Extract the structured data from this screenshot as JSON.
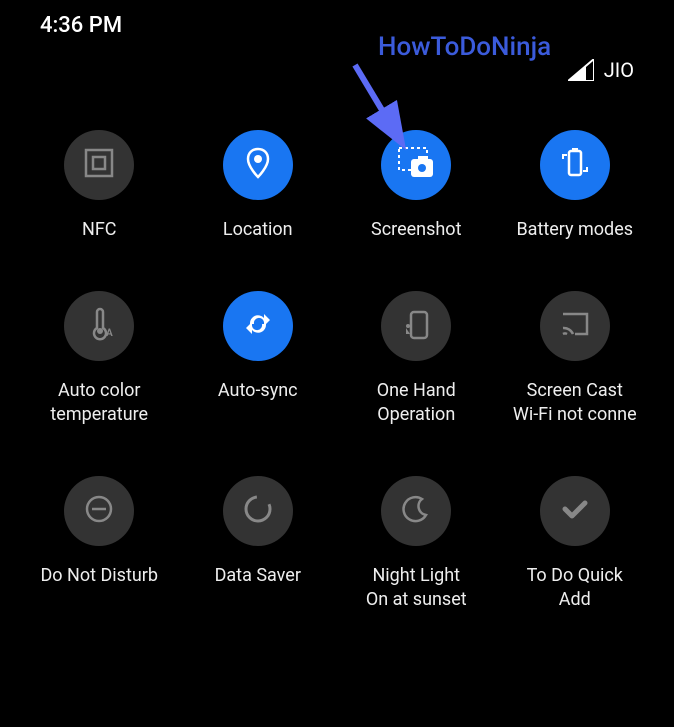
{
  "status": {
    "time": "4:36 PM",
    "carrier": "JIO"
  },
  "annotation": {
    "text": "HowToDoNinja"
  },
  "tiles": [
    {
      "label": "NFC",
      "active": false,
      "icon": "nfc"
    },
    {
      "label": "Location",
      "active": true,
      "icon": "location"
    },
    {
      "label": "Screenshot",
      "active": true,
      "icon": "screenshot"
    },
    {
      "label": "Battery modes",
      "active": true,
      "icon": "battery"
    },
    {
      "label": "Auto color\ntemperature",
      "active": false,
      "icon": "thermometer"
    },
    {
      "label": "Auto-sync",
      "active": true,
      "icon": "sync"
    },
    {
      "label": "One Hand\nOperation",
      "active": false,
      "icon": "onehand"
    },
    {
      "label": "Screen Cast\nWi-Fi not conne",
      "active": false,
      "icon": "cast"
    },
    {
      "label": "Do Not Disturb",
      "active": false,
      "icon": "dnd"
    },
    {
      "label": "Data Saver",
      "active": false,
      "icon": "datasaver"
    },
    {
      "label": "Night Light\nOn at sunset",
      "active": false,
      "icon": "nightlight"
    },
    {
      "label": "To Do Quick\nAdd",
      "active": false,
      "icon": "todo"
    }
  ]
}
